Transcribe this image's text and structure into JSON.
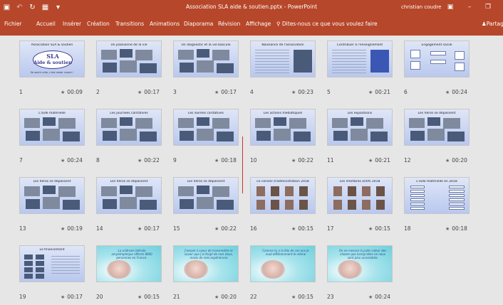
{
  "window": {
    "title": "Association SLA aide & soutien.pptx  -  PowerPoint",
    "user": "christian coudre",
    "qat": {
      "save_icon": "save-icon",
      "undo_icon": "undo-icon",
      "redo_icon": "redo-icon",
      "present_icon": "present-from-start-icon",
      "customize_icon": "customize-qat-icon"
    },
    "controls": {
      "ribbon_display_icon": "ribbon-display-options-icon",
      "minimize_icon": "minimize-icon",
      "maximize_icon": "restore-icon"
    }
  },
  "ribbon": {
    "tabs": [
      "Fichier",
      "Accueil",
      "Insérer",
      "Création",
      "Transitions",
      "Animations",
      "Diaporama",
      "Révision",
      "Affichage"
    ],
    "tell_me": "Dites-nous ce que vous voulez faire",
    "tell_me_icon": "lightbulb-icon",
    "share": "Partager",
    "share_icon": "person-icon"
  },
  "logo": {
    "line1": "SLA",
    "line2": "Aide & soutien",
    "caption": "Se sentir utile, c'est rester vivant !"
  },
  "slides": [
    {
      "number": "1",
      "title": "Association SLA & soutien",
      "duration": "00:09",
      "style": "logo"
    },
    {
      "number": "2",
      "title": "Un passionné de la vie",
      "duration": "00:17",
      "style": "photos"
    },
    {
      "number": "3",
      "title": "Un diagnostic et la vie bascule",
      "duration": "00:17",
      "style": "photos"
    },
    {
      "number": "4",
      "title": "Naissance de l'association",
      "duration": "00:23",
      "style": "text"
    },
    {
      "number": "5",
      "title": "Contribuer à l'enseignement",
      "duration": "00:21",
      "style": "text"
    },
    {
      "number": "6",
      "title": "Engagement social",
      "duration": "00:24",
      "style": "diagram"
    },
    {
      "number": "7",
      "title": "L'aide matérielle",
      "duration": "00:24",
      "style": "photos"
    },
    {
      "number": "8",
      "title": "Les journées caritatives",
      "duration": "00:22",
      "style": "photos"
    },
    {
      "number": "9",
      "title": "Les soirées caritatives",
      "duration": "00:18",
      "style": "photos"
    },
    {
      "number": "10",
      "title": "Les actions médiatiques",
      "duration": "00:22",
      "style": "photos"
    },
    {
      "number": "11",
      "title": "Les expositions",
      "duration": "00:21",
      "style": "photos"
    },
    {
      "number": "12",
      "title": "Les héros se dépassent",
      "duration": "00:20",
      "style": "photos"
    },
    {
      "number": "13",
      "title": "Les héros se dépassent",
      "duration": "00:19",
      "style": "photos"
    },
    {
      "number": "14",
      "title": "Les héros se dépassent",
      "duration": "00:17",
      "style": "photos"
    },
    {
      "number": "15",
      "title": "Les héros se dépassent",
      "duration": "00:22",
      "style": "photos"
    },
    {
      "number": "16",
      "title": "Le conseil d'administration 2018",
      "duration": "00:15",
      "style": "faces"
    },
    {
      "number": "17",
      "title": "Les membres actifs 2018",
      "duration": "00:15",
      "style": "faces"
    },
    {
      "number": "18",
      "title": "L'aide matérielle en 2018",
      "duration": "00:18",
      "style": "chart"
    },
    {
      "number": "19",
      "title": "Le financement",
      "duration": "00:17",
      "style": "logos"
    },
    {
      "number": "20",
      "title": "",
      "duration": "00:15",
      "style": "quote",
      "quote": "La sclérose latérale amyotrophique affecte 8000 personnes en France."
    },
    {
      "number": "21",
      "title": "",
      "duration": "00:20",
      "style": "quote",
      "quote": "J'essaie à coeur de transmettre le savoir que j'ai forgé de mes doux, rendu de mes expériences"
    },
    {
      "number": "22",
      "title": "",
      "duration": "00:15",
      "style": "quote",
      "quote": "Comme tu a la fois de ces ans je mad différemment le même"
    },
    {
      "number": "23",
      "title": "",
      "duration": "00:24",
      "style": "quote",
      "quote": "On ne mesure la juste valeur des choses que lorsqu'elles ne nous sont plus accessibles"
    }
  ],
  "colors": {
    "accent": "#b7472a",
    "workspace": "#e6e6e6",
    "slide_bg": "#c9d5f2"
  }
}
